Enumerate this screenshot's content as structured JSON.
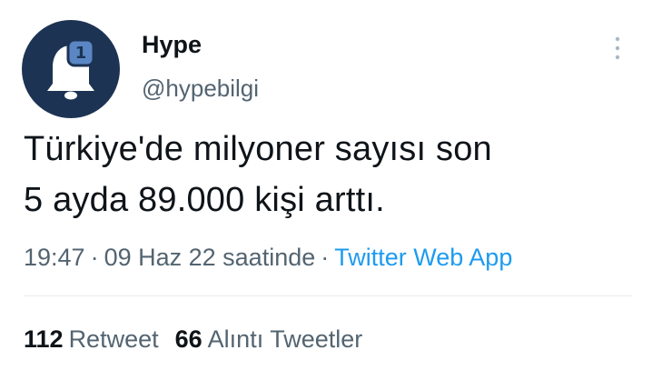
{
  "tweet": {
    "author_name": "Hype",
    "author_handle": "@hypebilgi",
    "text_line1": "Türkiye'de milyoner sayısı son",
    "text_line2": "5 ayda 89.000 kişi arttı.",
    "time": "19:47",
    "date": "09 Haz 22 saatinde",
    "separator": "·",
    "source": "Twitter Web App"
  },
  "avatar": {
    "badge_count": "1",
    "background_color": "#1d3353",
    "badge_color": "#5a86c4"
  },
  "stats": {
    "retweets": {
      "count": "112",
      "label": "Retweet"
    },
    "quotes": {
      "count": "66",
      "label": "Alıntı Tweetler"
    }
  },
  "icons": {
    "more": "more-vertical-icon",
    "avatar": "bell-icon"
  },
  "colors": {
    "text": "#0f1419",
    "secondary": "#536471",
    "link": "#1d9bf0",
    "divider": "#e6ecf0"
  }
}
